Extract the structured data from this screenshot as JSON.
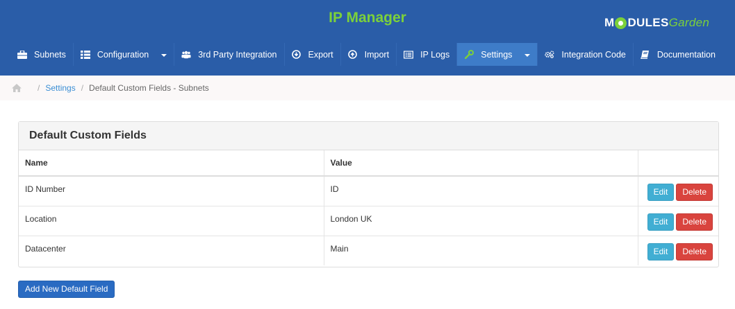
{
  "app": {
    "title": "IP Manager",
    "logo_m": "M",
    "logo_dules": "DULES",
    "logo_garden": "Garden"
  },
  "nav": [
    {
      "label": "Subnets",
      "icon": "briefcase-icon"
    },
    {
      "label": "Configuration",
      "icon": "grid-icon",
      "dropdown": true
    },
    {
      "label": "3rd Party Integration",
      "icon": "users-icon"
    },
    {
      "label": "Export",
      "icon": "download-icon"
    },
    {
      "label": "Import",
      "icon": "upload-icon"
    },
    {
      "label": "IP Logs",
      "icon": "list-icon"
    },
    {
      "label": "Settings",
      "icon": "wrench-icon",
      "dropdown": true,
      "active": true
    },
    {
      "label": "Integration Code",
      "icon": "gears-icon"
    },
    {
      "label": "Documentation",
      "icon": "book-icon"
    }
  ],
  "breadcrumb": {
    "home_icon": "home-icon",
    "settings": "Settings",
    "current": "Default Custom Fields - Subnets",
    "separator": "/"
  },
  "panel": {
    "title": "Default Custom Fields",
    "columns": [
      "Name",
      "Value",
      ""
    ],
    "rows": [
      {
        "name": "ID Number",
        "value": "ID"
      },
      {
        "name": "Location",
        "value": "London UK"
      },
      {
        "name": "Datacenter",
        "value": "Main"
      }
    ],
    "edit_label": "Edit",
    "delete_label": "Delete"
  },
  "add_button": "Add New Default Field",
  "colors": {
    "header_bg": "#2a5da8",
    "title_green": "#7cd13a",
    "active_nav": "#3e7cc8",
    "edit_btn": "#41aed3",
    "delete_btn": "#d9443e",
    "primary_btn": "#2a6bc2"
  }
}
